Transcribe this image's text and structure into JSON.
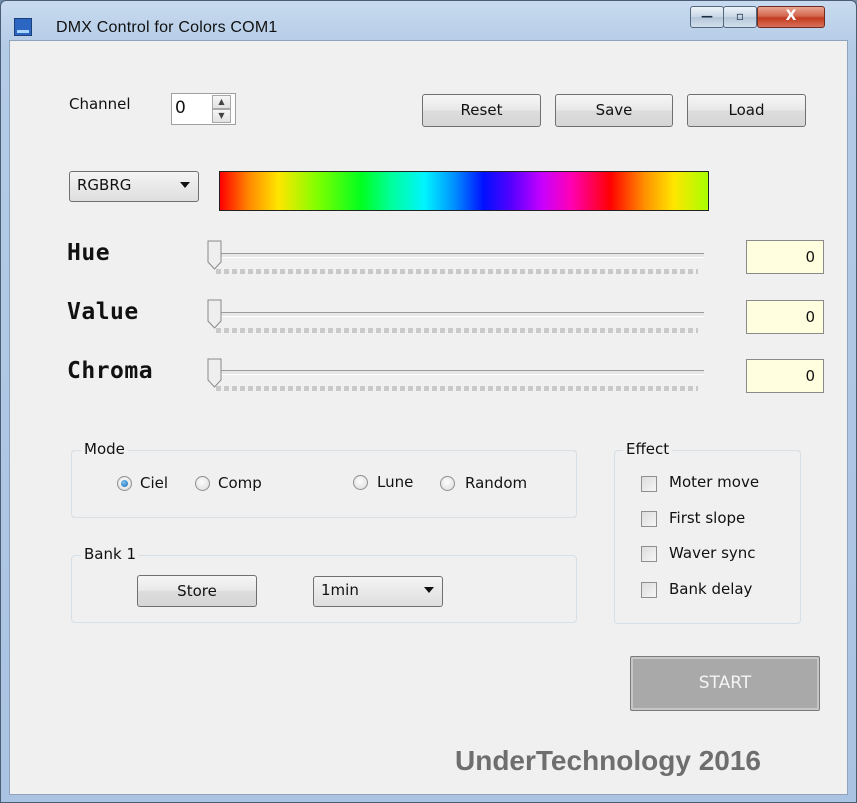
{
  "window": {
    "title": "DMX Control for Colors  COM1",
    "controls": {
      "minimize": "—",
      "maximize": "▫",
      "close": "X"
    }
  },
  "channel": {
    "label": "Channel",
    "value": "0"
  },
  "toolbar": {
    "reset_label": "Reset",
    "save_label": "Save",
    "load_label": "Load"
  },
  "palette": {
    "selected": "RGBRG"
  },
  "sliders": [
    {
      "label": "Hue",
      "value": "0"
    },
    {
      "label": "Value",
      "value": "0"
    },
    {
      "label": "Chroma",
      "value": "0"
    }
  ],
  "mode": {
    "title": "Mode",
    "options": [
      {
        "label": "Ciel",
        "selected": true
      },
      {
        "label": "Comp",
        "selected": false
      },
      {
        "label": "Lune",
        "selected": false
      },
      {
        "label": "Random",
        "selected": false
      }
    ]
  },
  "bank": {
    "title": "Bank 1",
    "store_label": "Store",
    "interval": "1min"
  },
  "effect": {
    "title": "Effect",
    "options": [
      {
        "label": "Moter move",
        "checked": false
      },
      {
        "label": "First slope",
        "checked": false
      },
      {
        "label": "Waver sync",
        "checked": false
      },
      {
        "label": "Bank delay",
        "checked": false
      }
    ]
  },
  "start_label": "START",
  "brand": "UnderTechnology 2016",
  "colors": {
    "value_box": "#ffffe0",
    "radio_selected": "#1565b0",
    "start_disabled": "#a9a9a9"
  }
}
